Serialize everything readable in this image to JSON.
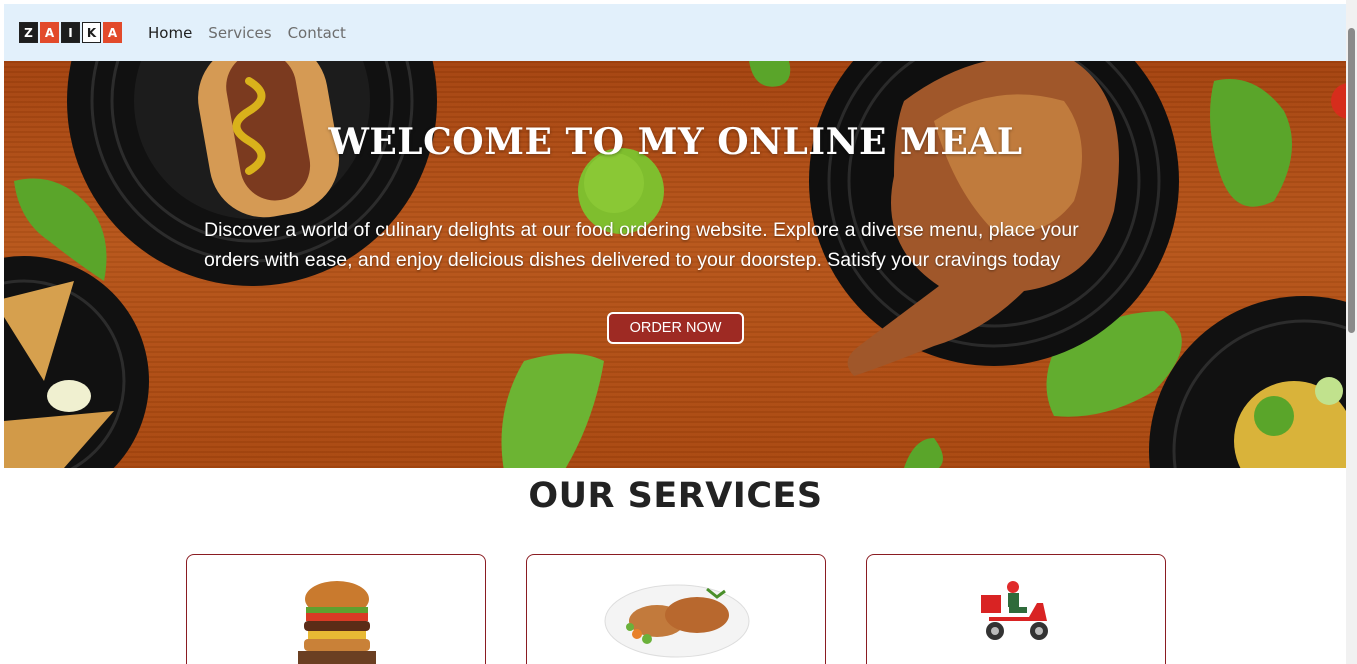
{
  "nav": {
    "logo_letters": [
      "Z",
      "A",
      "I",
      "K",
      "A"
    ],
    "links": [
      {
        "label": "Home",
        "active": true
      },
      {
        "label": "Services",
        "active": false
      },
      {
        "label": "Contact",
        "active": false
      }
    ]
  },
  "hero": {
    "title": "WELCOME TO MY ONLINE MEAL",
    "description": "Discover a world of culinary delights at our food ordering website. Explore a diverse menu, place your orders with ease, and enjoy delicious dishes delivered to your doorstep. Satisfy your cravings today",
    "cta_label": "ORDER NOW"
  },
  "services": {
    "title": "OUR SERVICES",
    "cards": [
      {
        "icon": "burger-icon"
      },
      {
        "icon": "chicken-plate-icon"
      },
      {
        "icon": "delivery-scooter-icon"
      }
    ]
  },
  "colors": {
    "navbar_bg": "#e2f0fb",
    "cta_bg": "#9e2a23",
    "card_border": "#8a1c22",
    "logo_accent": "#e24a2b"
  }
}
